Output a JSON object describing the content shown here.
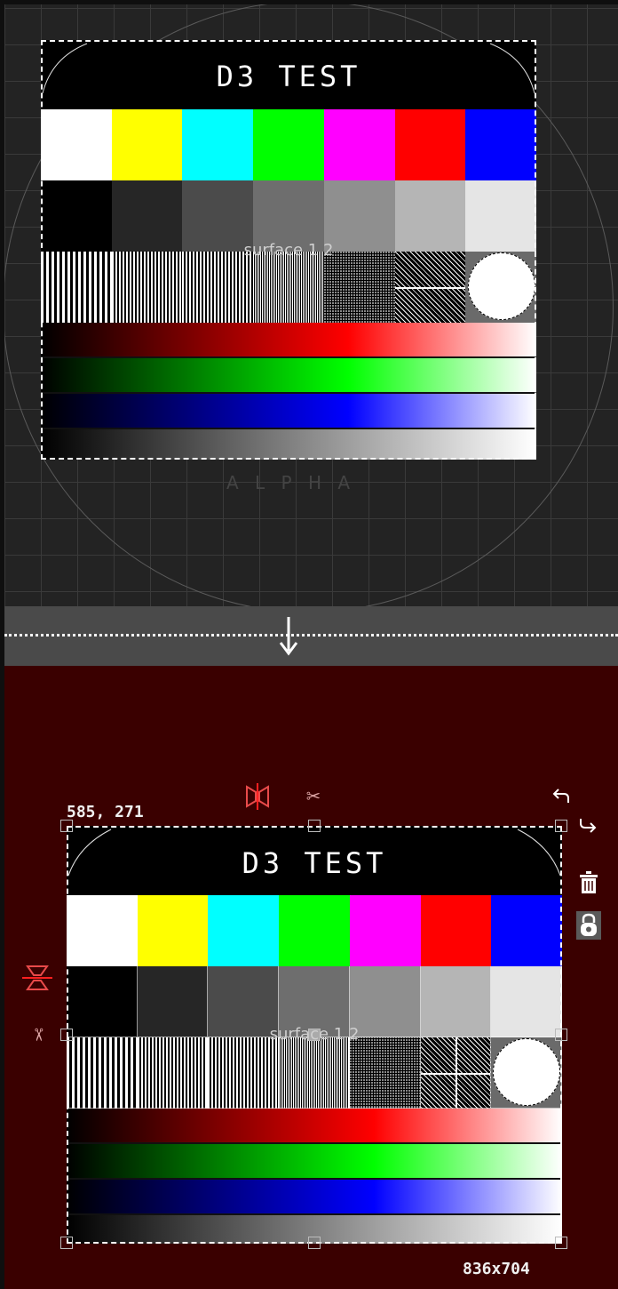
{
  "card": {
    "title": "D3 TEST",
    "surface_label": "surface 1 2",
    "color_bars": [
      "#ffffff",
      "#ffff00",
      "#00ffff",
      "#00ff00",
      "#ff00ff",
      "#ff0000",
      "#0000ff"
    ],
    "gray_bars": [
      "#000000",
      "#262626",
      "#4b4b4b",
      "#6e6e6e",
      "#8f8f8f",
      "#b5b5b5",
      "#e5e5e5"
    ],
    "gradients": [
      "red-ramp",
      "green-ramp",
      "blue-ramp",
      "gray-ramp"
    ]
  },
  "top_view": {
    "watermark": "A L P H A"
  },
  "transition": {
    "arrow_icon": "arrow-down-icon"
  },
  "editor": {
    "coordinates": "585, 271",
    "size": "836x704",
    "icons": [
      "flip-horizontal-icon",
      "cut-icon",
      "undo-icon",
      "redo-icon",
      "trash-icon",
      "lock-icon",
      "flip-vertical-icon"
    ]
  },
  "colors": {
    "accent_red": "#e23a3a",
    "bottom_bg": "#3a0000",
    "top_bg": "#232323"
  }
}
